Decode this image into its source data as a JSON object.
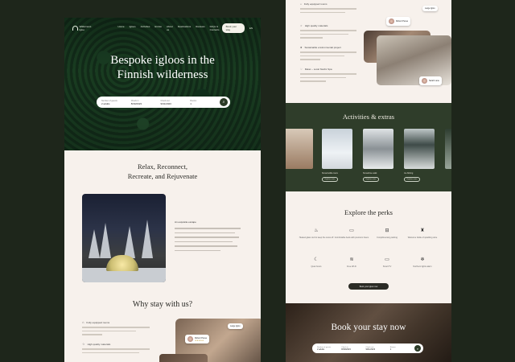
{
  "left": {
    "nav": {
      "logo": "Wilderness Igloo",
      "links": [
        "Home",
        "Igloos",
        "Activities",
        "Extras",
        "About us",
        "Destinations",
        "Reviews",
        "FAQs & Contacts"
      ],
      "cta": "Book your stay",
      "lang": "EN"
    },
    "hero": {
      "title_line1": "Bespoke igloos in the",
      "title_line2": "Finnish wilderness"
    },
    "search": {
      "fields": [
        {
          "label": "Number of guests",
          "value": "2 adults"
        },
        {
          "label": "Check in",
          "value": "8/30/2023"
        },
        {
          "label": "Check out",
          "value": "9/01/2023"
        },
        {
          "label": "Rooms",
          "value": "1"
        }
      ],
      "button_icon": "search-icon"
    },
    "intro": {
      "line1": "Relax, Reconnect,",
      "line2": "Recreate, and Rejuvenate"
    },
    "about": {
      "heading": "An exquisite escape"
    },
    "why_title": "Why stay with us?",
    "features": [
      {
        "icon": "home-icon",
        "title": "Fully equipped rooms"
      },
      {
        "icon": "star-icon",
        "title": "High quality materials"
      }
    ],
    "review_chip": {
      "name": "Robert Perea",
      "rating": "★★★★★"
    },
    "tag_chip": "Large Igloo"
  },
  "right": {
    "features": [
      {
        "icon": "home-icon",
        "title": "Fully equipped rooms"
      },
      {
        "icon": "star-icon",
        "title": "High quality materials"
      },
      {
        "icon": "leaf-icon",
        "title": "Sustainable environmental project"
      },
      {
        "icon": "heart-icon",
        "title": "Relax – Local Nordic Spa"
      }
    ],
    "chip_top": {
      "name": "Robert Perea"
    },
    "chip_top_tag": "Large Igloo",
    "chip_bottom": {
      "name": "Sarah Lane"
    },
    "activities": {
      "title": "Activities & extras",
      "items": [
        {
          "label": "",
          "button": ""
        },
        {
          "label": "Snowmobile tours",
          "button": "Explore more"
        },
        {
          "label": "Snowshoe walk",
          "button": "Explore more"
        },
        {
          "label": "Ice fishing",
          "button": "Explore more"
        },
        {
          "label": "",
          "button": ""
        }
      ]
    },
    "perks": {
      "title": "Explore the perks",
      "items": [
        {
          "icon": "thermometer-icon",
          "text": "Heated glass roof to keep the snow off"
        },
        {
          "icon": "bed-icon",
          "text": "Comfortable beds with premium linens"
        },
        {
          "icon": "car-icon",
          "text": "Complimentary parking"
        },
        {
          "icon": "bottle-icon",
          "text": "Welcome bottle of sparkling wine"
        },
        {
          "icon": "moon-icon",
          "text": "Quiet hours"
        },
        {
          "icon": "wifi-icon",
          "text": "Free Wi-Fi"
        },
        {
          "icon": "tv-icon",
          "text": "Smart TV"
        },
        {
          "icon": "snowflake-icon",
          "text": "Northern lights alarm"
        }
      ],
      "button": "Book your igloo now"
    },
    "book": {
      "title": "Book your stay now",
      "fields": [
        {
          "label": "Number of guests",
          "value": "2 adults"
        },
        {
          "label": "Check in",
          "value": "8/30/2023"
        },
        {
          "label": "Check out",
          "value": "9/01/2023"
        },
        {
          "label": "Rooms",
          "value": "1"
        }
      ]
    }
  }
}
